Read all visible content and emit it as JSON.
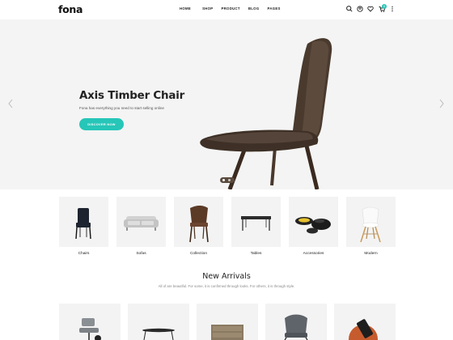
{
  "header": {
    "logo": "fona",
    "nav": [
      "HOME",
      "SHOP",
      "PRODUCT",
      "BLOG",
      "PAGES"
    ],
    "icons": [
      "search-icon",
      "account-icon",
      "wishlist-icon",
      "cart-icon",
      "more-icon"
    ],
    "cart_count": "0"
  },
  "hero": {
    "title": "Axis Timber Chair",
    "subtitle": "Fona has everything you need to start selling online",
    "button": "DISCOVER NOW"
  },
  "categories": [
    {
      "label": "Chairs"
    },
    {
      "label": "Sofas"
    },
    {
      "label": "Collection"
    },
    {
      "label": "Tables"
    },
    {
      "label": "Accessories"
    },
    {
      "label": "Modern"
    }
  ],
  "new_arrivals": {
    "title": "New Arrivals",
    "subtitle": "All of are beautiful. For some, it is confirmed through looks. For others, it is through style."
  },
  "colors": {
    "accent": "#26c6b8",
    "hero_bg": "#f4f4f4",
    "tile_bg": "#f3f3f3"
  }
}
